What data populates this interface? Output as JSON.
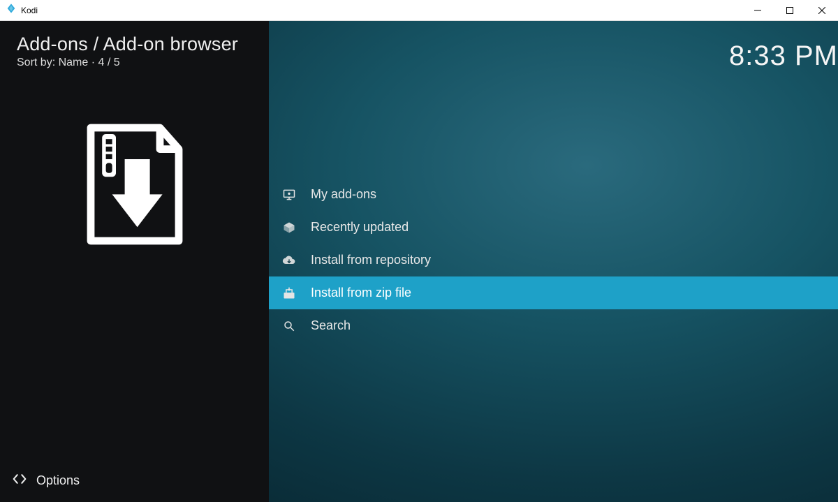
{
  "window": {
    "title": "Kodi"
  },
  "header": {
    "breadcrumb": "Add-ons / Add-on browser",
    "sort": "Sort by: Name  ·  4 / 5"
  },
  "clock": "8:33 PM",
  "menu": {
    "items": [
      {
        "label": "My add-ons",
        "icon": "monitor-addons-icon",
        "selected": false
      },
      {
        "label": "Recently updated",
        "icon": "open-box-icon",
        "selected": false
      },
      {
        "label": "Install from repository",
        "icon": "cloud-download-icon",
        "selected": false
      },
      {
        "label": "Install from zip file",
        "icon": "zip-install-icon",
        "selected": true
      },
      {
        "label": "Search",
        "icon": "search-icon",
        "selected": false
      }
    ]
  },
  "footer": {
    "options_label": "Options"
  }
}
